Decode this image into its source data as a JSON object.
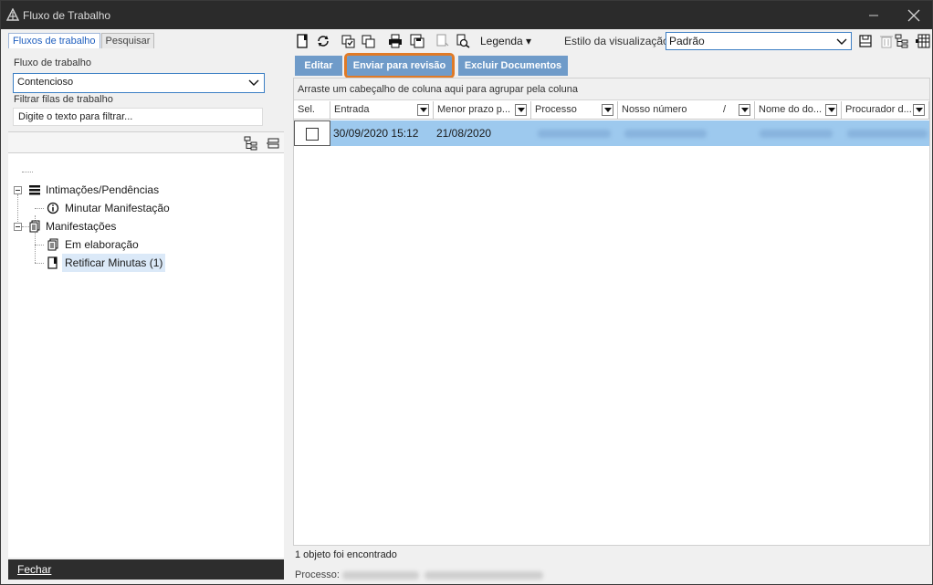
{
  "window": {
    "title": "Fluxo de Trabalho",
    "app_icon": "fluxo-icon"
  },
  "left": {
    "tabs": [
      {
        "label": "Fluxos de trabalho",
        "active": true
      },
      {
        "label": "Pesquisar",
        "active": false
      }
    ],
    "fluxo_label": "Fluxo de trabalho",
    "fluxo_value": "Contencioso",
    "filtrar_label": "Filtrar filas de trabalho",
    "filter_text": "Digite o texto para filtrar...",
    "tree": [
      {
        "label": "Intimações/Pendências",
        "icon": "list-icon",
        "level": 0
      },
      {
        "label": "Minutar Manifestação",
        "icon": "info-icon",
        "level": 1
      },
      {
        "label": "Manifestações",
        "icon": "documents-icon",
        "level": 0
      },
      {
        "label": "Em elaboração",
        "icon": "documents-icon",
        "level": 1
      },
      {
        "label": "Retificar Minutas (1)",
        "icon": "document-icon",
        "level": 1,
        "selected": true
      }
    ],
    "close_label": "Fechar"
  },
  "right": {
    "legenda_label": "Legenda ▾",
    "estilo_label": "Estilo da visualização",
    "estilo_value": "Padrão",
    "actions": {
      "editar": "Editar",
      "enviar": "Enviar para revisão",
      "excluir": "Excluir Documentos"
    },
    "group_hint": "Arraste um cabeçalho de coluna aqui para agrupar pela coluna",
    "columns": {
      "sel": "Sel.",
      "entrada": "Entrada",
      "menor_prazo": "Menor prazo p...",
      "processo": "Processo",
      "nosso_numero": "Nosso número",
      "nome_do": "Nome do do...",
      "procurador": "Procurador d..."
    },
    "sort_marker": "/",
    "row": {
      "entrada": "30/09/2020 15:12",
      "menor_prazo": "21/08/2020"
    },
    "status": "1 objeto foi encontrado",
    "processo_label": "Processo:"
  },
  "colors": {
    "accent": "#6f9bc9",
    "highlight": "#e07a26",
    "selected_row": "#9dc9ee",
    "titlebar": "#2b2b2b"
  }
}
